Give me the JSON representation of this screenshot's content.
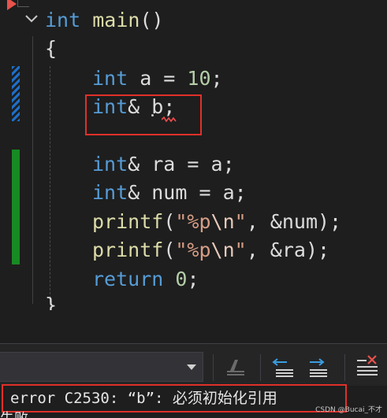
{
  "editor": {
    "lines": [
      {
        "parts": [
          {
            "t": "int",
            "c": "kw"
          },
          {
            "t": " ",
            "c": "punc"
          },
          {
            "t": "main",
            "c": "fn"
          },
          {
            "t": "()",
            "c": "punc"
          }
        ]
      },
      {
        "parts": [
          {
            "t": "{",
            "c": "punc"
          }
        ]
      },
      {
        "parts": [
          {
            "t": "int",
            "c": "kw"
          },
          {
            "t": " a = ",
            "c": "punc"
          },
          {
            "t": "10",
            "c": "num"
          },
          {
            "t": ";",
            "c": "punc"
          }
        ]
      },
      {
        "parts": [
          {
            "t": "int",
            "c": "kw"
          },
          {
            "t": "& b;",
            "c": "punc"
          }
        ]
      },
      {
        "parts": [
          {
            "t": "",
            "c": "punc"
          }
        ]
      },
      {
        "parts": [
          {
            "t": "int",
            "c": "kw"
          },
          {
            "t": "& ra = a;",
            "c": "punc"
          }
        ]
      },
      {
        "parts": [
          {
            "t": "int",
            "c": "kw"
          },
          {
            "t": "& num = a;",
            "c": "punc"
          }
        ]
      },
      {
        "parts": [
          {
            "t": "printf",
            "c": "fn"
          },
          {
            "t": "(",
            "c": "punc"
          },
          {
            "t": "\"%p",
            "c": "str"
          },
          {
            "t": "\\n",
            "c": "esc"
          },
          {
            "t": "\"",
            "c": "str"
          },
          {
            "t": ", &num);",
            "c": "punc"
          }
        ]
      },
      {
        "parts": [
          {
            "t": "printf",
            "c": "fn"
          },
          {
            "t": "(",
            "c": "punc"
          },
          {
            "t": "\"%p",
            "c": "str"
          },
          {
            "t": "\\n",
            "c": "esc"
          },
          {
            "t": "\"",
            "c": "str"
          },
          {
            "t": ", &ra);",
            "c": "punc"
          }
        ]
      },
      {
        "parts": [
          {
            "t": "return",
            "c": "kw"
          },
          {
            "t": " ",
            "c": "punc"
          },
          {
            "t": "0",
            "c": "num"
          },
          {
            "t": ";",
            "c": "punc"
          }
        ]
      }
    ],
    "closing_brace": "}"
  },
  "error_list": {
    "dropdown_value": "",
    "error_message": "error C2530: “b”: 必须初始化引用",
    "next_line_fragment": "失败"
  },
  "watermark": "CSDN @Bucai_不才",
  "colors": {
    "keyword": "#569cd6",
    "function": "#dcdcaa",
    "string": "#d69d85",
    "number": "#b5cea8",
    "highlight_box": "#e0302a",
    "change_bar_saved": "#188a23",
    "change_bar_unsaved": "#1e6fc8"
  },
  "icons": {
    "breakpoint_arrow": "current-statement-arrow-icon",
    "fold": "chevron-down-icon",
    "toolbar": [
      "clear-icon",
      "previous-error-icon",
      "next-error-icon",
      "clear-all-icon"
    ]
  }
}
